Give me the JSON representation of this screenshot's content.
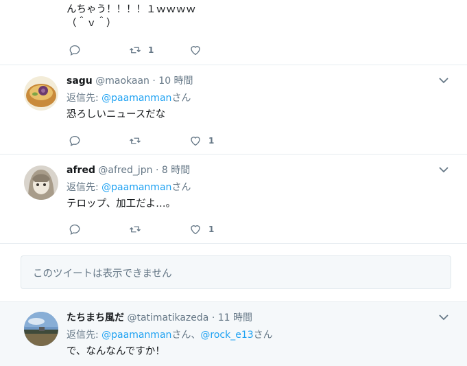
{
  "tweets": [
    {
      "text_lines": [
        "んちゃう！！！！１ｗｗｗｗ",
        "（＾ｖ＾）"
      ],
      "reply_count": "",
      "retweet_count": "1",
      "like_count": ""
    },
    {
      "name": "sagu",
      "handle": "@maokaan",
      "dot": "·",
      "time": "10 時間",
      "reply_prefix": "返信先: ",
      "reply_to": "@paamanman",
      "reply_suffix": "さん",
      "text": "恐ろしいニュースだな",
      "retweet_count": "",
      "like_count": "1"
    },
    {
      "name": "afred",
      "handle": "@afred_jpn",
      "dot": "·",
      "time": "8 時間",
      "reply_prefix": "返信先: ",
      "reply_to": "@paamanman",
      "reply_suffix": "さん",
      "text": "テロップ、加工だよ…。",
      "retweet_count": "",
      "like_count": "1"
    },
    {
      "name": "たちまち風だ",
      "handle": "@tatimatikazeda",
      "dot": "·",
      "time": "11 時間",
      "reply_prefix": "返信先: ",
      "reply_to": "@paamanman",
      "reply_mid": "さん、",
      "reply_to_2": "@rock_e13",
      "reply_suffix": "さん",
      "text": "で、なんなんですか！"
    }
  ],
  "unavailable_notice": "このツイートは表示できません",
  "icons": {
    "reply": "reply-icon",
    "retweet": "retweet-icon",
    "like": "heart-icon",
    "more": "chevron-down-icon"
  },
  "colors": {
    "link": "#1da1f2",
    "muted": "#657786",
    "text": "#14171a",
    "divider": "#e6ecf0"
  }
}
